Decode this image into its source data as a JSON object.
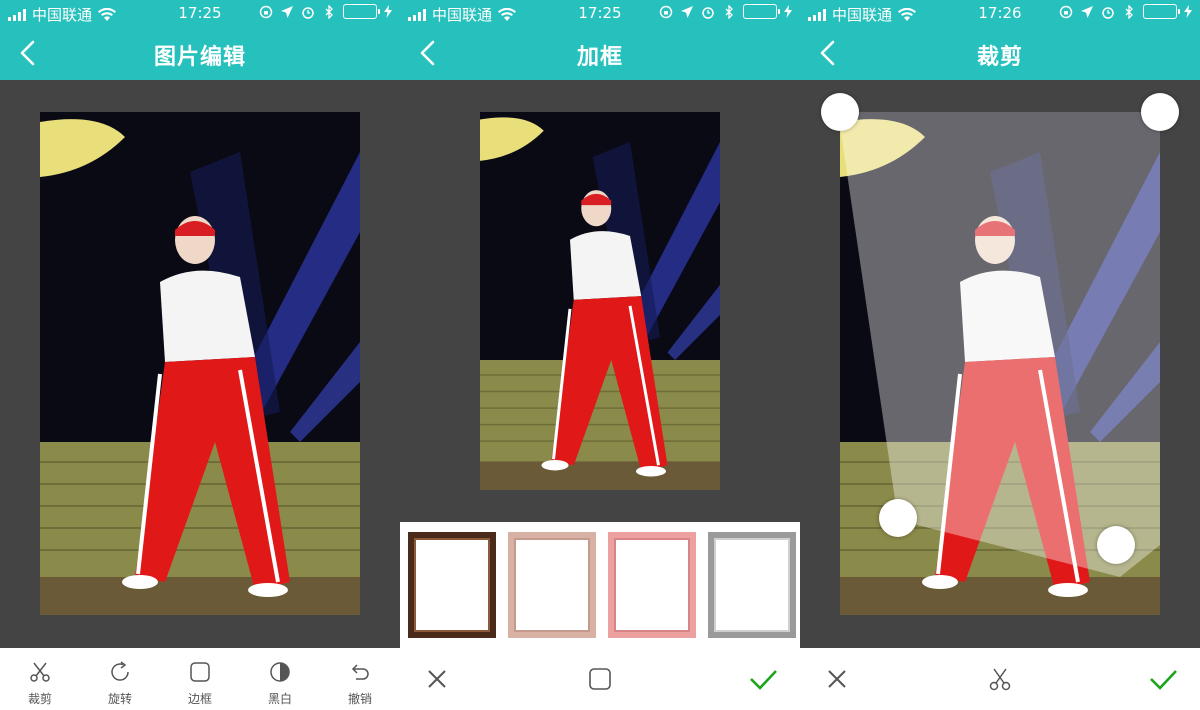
{
  "status": {
    "carrier": "中国联通",
    "battery_color": "#5ef05a"
  },
  "screens": [
    {
      "time": "17:25",
      "title": "图片编辑",
      "tools": [
        {
          "label": "裁剪",
          "icon": "scissors-icon"
        },
        {
          "label": "旋转",
          "icon": "rotate-icon"
        },
        {
          "label": "边框",
          "icon": "frame-icon"
        },
        {
          "label": "黑白",
          "icon": "contrast-icon"
        },
        {
          "label": "撤销",
          "icon": "undo-icon"
        }
      ]
    },
    {
      "time": "17:25",
      "title": "加框",
      "frames": [
        {
          "name": "dark-wood-frame",
          "color": "#4a2a1a"
        },
        {
          "name": "beige-frame",
          "color": "#d8b0a4"
        },
        {
          "name": "pink-frame",
          "color": "#eda0a0"
        },
        {
          "name": "silver-frame",
          "color": "#9a9a9a"
        }
      ],
      "actions": {
        "cancel": "close-icon",
        "middle": "frame-icon",
        "confirm": "check-icon"
      }
    },
    {
      "time": "17:26",
      "title": "裁剪",
      "actions": {
        "cancel": "close-icon",
        "middle": "scissors-icon",
        "confirm": "check-icon"
      }
    }
  ],
  "colors": {
    "header": "#26c0bd",
    "canvas": "#444444",
    "confirm": "#1aa51a"
  }
}
